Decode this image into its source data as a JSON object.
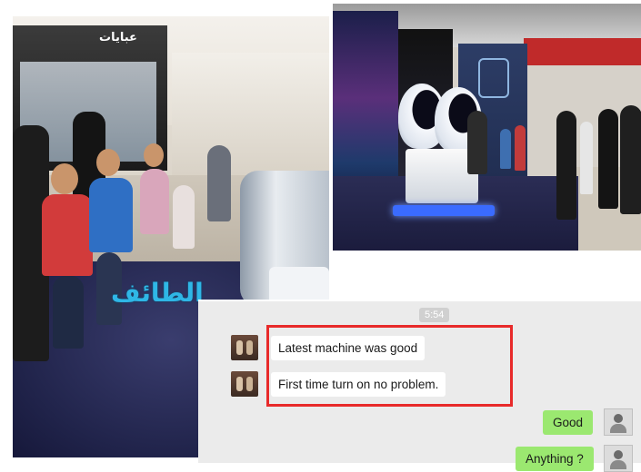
{
  "left_photo": {
    "store_sign": "عبايات",
    "watermark": "الطائف"
  },
  "right_photo": {
    "banner_logo": "VR"
  },
  "chat": {
    "timestamp": "5:54",
    "messages": [
      {
        "side": "other",
        "text": "Latest machine was good"
      },
      {
        "side": "other",
        "text": "First time turn on no problem."
      },
      {
        "side": "me",
        "text": "Good"
      },
      {
        "side": "me",
        "text": "Anything ?"
      }
    ],
    "highlight_color": "#e82a2a",
    "bubble_me_color": "#9be870"
  }
}
